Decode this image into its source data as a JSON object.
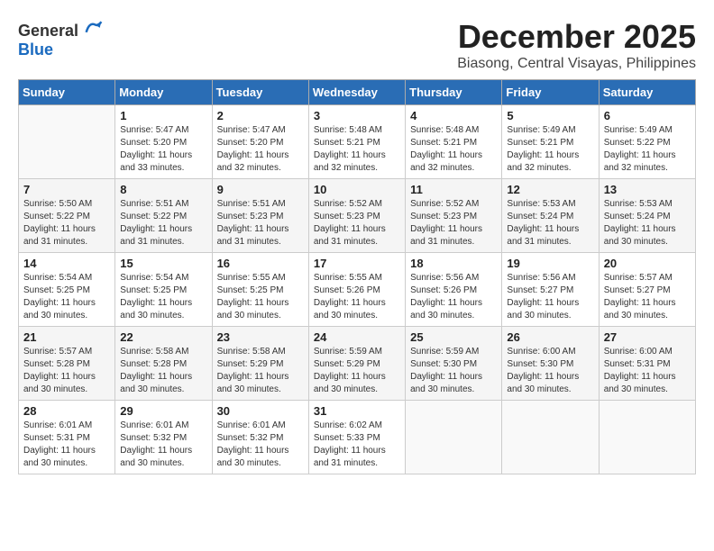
{
  "app": {
    "logo_general": "General",
    "logo_blue": "Blue"
  },
  "header": {
    "title": "December 2025",
    "location": "Biasong, Central Visayas, Philippines"
  },
  "weekdays": [
    "Sunday",
    "Monday",
    "Tuesday",
    "Wednesday",
    "Thursday",
    "Friday",
    "Saturday"
  ],
  "weeks": [
    [
      {
        "day": "",
        "sunrise": "",
        "sunset": "",
        "daylight": ""
      },
      {
        "day": "1",
        "sunrise": "Sunrise: 5:47 AM",
        "sunset": "Sunset: 5:20 PM",
        "daylight": "Daylight: 11 hours and 33 minutes."
      },
      {
        "day": "2",
        "sunrise": "Sunrise: 5:47 AM",
        "sunset": "Sunset: 5:20 PM",
        "daylight": "Daylight: 11 hours and 32 minutes."
      },
      {
        "day": "3",
        "sunrise": "Sunrise: 5:48 AM",
        "sunset": "Sunset: 5:21 PM",
        "daylight": "Daylight: 11 hours and 32 minutes."
      },
      {
        "day": "4",
        "sunrise": "Sunrise: 5:48 AM",
        "sunset": "Sunset: 5:21 PM",
        "daylight": "Daylight: 11 hours and 32 minutes."
      },
      {
        "day": "5",
        "sunrise": "Sunrise: 5:49 AM",
        "sunset": "Sunset: 5:21 PM",
        "daylight": "Daylight: 11 hours and 32 minutes."
      },
      {
        "day": "6",
        "sunrise": "Sunrise: 5:49 AM",
        "sunset": "Sunset: 5:22 PM",
        "daylight": "Daylight: 11 hours and 32 minutes."
      }
    ],
    [
      {
        "day": "7",
        "sunrise": "Sunrise: 5:50 AM",
        "sunset": "Sunset: 5:22 PM",
        "daylight": "Daylight: 11 hours and 31 minutes."
      },
      {
        "day": "8",
        "sunrise": "Sunrise: 5:51 AM",
        "sunset": "Sunset: 5:22 PM",
        "daylight": "Daylight: 11 hours and 31 minutes."
      },
      {
        "day": "9",
        "sunrise": "Sunrise: 5:51 AM",
        "sunset": "Sunset: 5:23 PM",
        "daylight": "Daylight: 11 hours and 31 minutes."
      },
      {
        "day": "10",
        "sunrise": "Sunrise: 5:52 AM",
        "sunset": "Sunset: 5:23 PM",
        "daylight": "Daylight: 11 hours and 31 minutes."
      },
      {
        "day": "11",
        "sunrise": "Sunrise: 5:52 AM",
        "sunset": "Sunset: 5:23 PM",
        "daylight": "Daylight: 11 hours and 31 minutes."
      },
      {
        "day": "12",
        "sunrise": "Sunrise: 5:53 AM",
        "sunset": "Sunset: 5:24 PM",
        "daylight": "Daylight: 11 hours and 31 minutes."
      },
      {
        "day": "13",
        "sunrise": "Sunrise: 5:53 AM",
        "sunset": "Sunset: 5:24 PM",
        "daylight": "Daylight: 11 hours and 30 minutes."
      }
    ],
    [
      {
        "day": "14",
        "sunrise": "Sunrise: 5:54 AM",
        "sunset": "Sunset: 5:25 PM",
        "daylight": "Daylight: 11 hours and 30 minutes."
      },
      {
        "day": "15",
        "sunrise": "Sunrise: 5:54 AM",
        "sunset": "Sunset: 5:25 PM",
        "daylight": "Daylight: 11 hours and 30 minutes."
      },
      {
        "day": "16",
        "sunrise": "Sunrise: 5:55 AM",
        "sunset": "Sunset: 5:25 PM",
        "daylight": "Daylight: 11 hours and 30 minutes."
      },
      {
        "day": "17",
        "sunrise": "Sunrise: 5:55 AM",
        "sunset": "Sunset: 5:26 PM",
        "daylight": "Daylight: 11 hours and 30 minutes."
      },
      {
        "day": "18",
        "sunrise": "Sunrise: 5:56 AM",
        "sunset": "Sunset: 5:26 PM",
        "daylight": "Daylight: 11 hours and 30 minutes."
      },
      {
        "day": "19",
        "sunrise": "Sunrise: 5:56 AM",
        "sunset": "Sunset: 5:27 PM",
        "daylight": "Daylight: 11 hours and 30 minutes."
      },
      {
        "day": "20",
        "sunrise": "Sunrise: 5:57 AM",
        "sunset": "Sunset: 5:27 PM",
        "daylight": "Daylight: 11 hours and 30 minutes."
      }
    ],
    [
      {
        "day": "21",
        "sunrise": "Sunrise: 5:57 AM",
        "sunset": "Sunset: 5:28 PM",
        "daylight": "Daylight: 11 hours and 30 minutes."
      },
      {
        "day": "22",
        "sunrise": "Sunrise: 5:58 AM",
        "sunset": "Sunset: 5:28 PM",
        "daylight": "Daylight: 11 hours and 30 minutes."
      },
      {
        "day": "23",
        "sunrise": "Sunrise: 5:58 AM",
        "sunset": "Sunset: 5:29 PM",
        "daylight": "Daylight: 11 hours and 30 minutes."
      },
      {
        "day": "24",
        "sunrise": "Sunrise: 5:59 AM",
        "sunset": "Sunset: 5:29 PM",
        "daylight": "Daylight: 11 hours and 30 minutes."
      },
      {
        "day": "25",
        "sunrise": "Sunrise: 5:59 AM",
        "sunset": "Sunset: 5:30 PM",
        "daylight": "Daylight: 11 hours and 30 minutes."
      },
      {
        "day": "26",
        "sunrise": "Sunrise: 6:00 AM",
        "sunset": "Sunset: 5:30 PM",
        "daylight": "Daylight: 11 hours and 30 minutes."
      },
      {
        "day": "27",
        "sunrise": "Sunrise: 6:00 AM",
        "sunset": "Sunset: 5:31 PM",
        "daylight": "Daylight: 11 hours and 30 minutes."
      }
    ],
    [
      {
        "day": "28",
        "sunrise": "Sunrise: 6:01 AM",
        "sunset": "Sunset: 5:31 PM",
        "daylight": "Daylight: 11 hours and 30 minutes."
      },
      {
        "day": "29",
        "sunrise": "Sunrise: 6:01 AM",
        "sunset": "Sunset: 5:32 PM",
        "daylight": "Daylight: 11 hours and 30 minutes."
      },
      {
        "day": "30",
        "sunrise": "Sunrise: 6:01 AM",
        "sunset": "Sunset: 5:32 PM",
        "daylight": "Daylight: 11 hours and 30 minutes."
      },
      {
        "day": "31",
        "sunrise": "Sunrise: 6:02 AM",
        "sunset": "Sunset: 5:33 PM",
        "daylight": "Daylight: 11 hours and 31 minutes."
      },
      {
        "day": "",
        "sunrise": "",
        "sunset": "",
        "daylight": ""
      },
      {
        "day": "",
        "sunrise": "",
        "sunset": "",
        "daylight": ""
      },
      {
        "day": "",
        "sunrise": "",
        "sunset": "",
        "daylight": ""
      }
    ]
  ]
}
